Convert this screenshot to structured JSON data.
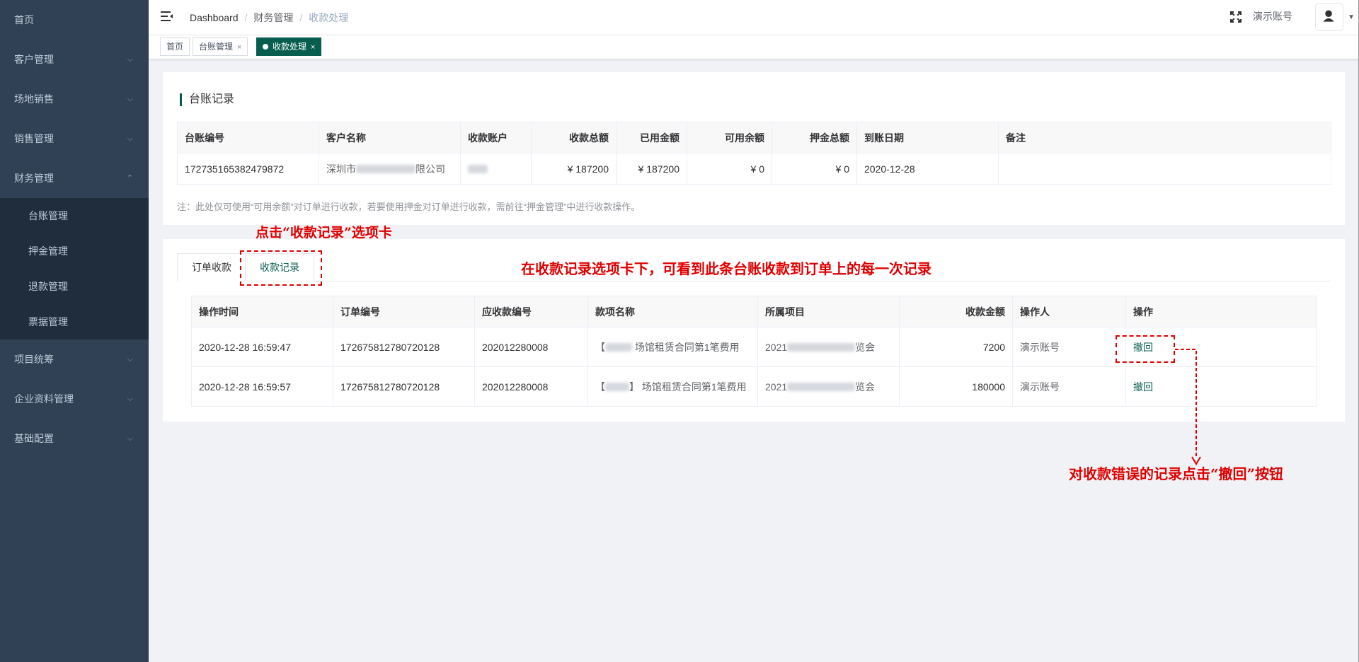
{
  "sidebar": {
    "items": [
      {
        "label": "首页",
        "arrow": ""
      },
      {
        "label": "客户管理",
        "arrow": "⌵"
      },
      {
        "label": "场地销售",
        "arrow": "⌵"
      },
      {
        "label": "销售管理",
        "arrow": "⌵"
      },
      {
        "label": "财务管理",
        "arrow": "⌃"
      }
    ],
    "finance_sub": [
      "台账管理",
      "押金管理",
      "退款管理",
      "票据管理"
    ],
    "items_after": [
      {
        "label": "项目统筹",
        "arrow": "⌵"
      },
      {
        "label": "企业资料管理",
        "arrow": "⌵"
      },
      {
        "label": "基础配置",
        "arrow": "⌵"
      }
    ]
  },
  "header": {
    "breadcrumb": [
      "Dashboard",
      "财务管理",
      "收款处理"
    ],
    "user_name": "演示账号"
  },
  "tags": [
    {
      "label": "首页",
      "closable": false,
      "active": false
    },
    {
      "label": "台账管理",
      "closable": true,
      "active": false
    },
    {
      "label": "收款处理",
      "closable": true,
      "active": true
    }
  ],
  "ledger": {
    "title": "台账记录",
    "columns": [
      "台账编号",
      "客户名称",
      "收款账户",
      "收款总额",
      "已用金额",
      "可用余额",
      "押金总额",
      "到账日期",
      "备注"
    ],
    "row": {
      "id": "172735165382479872",
      "customer_prefix": "深圳市",
      "customer_suffix": "限公司",
      "account": "",
      "total": "¥ 187200",
      "used": "¥ 187200",
      "available": "¥ 0",
      "deposit": "¥ 0",
      "date": "2020-12-28",
      "remark": ""
    },
    "note": "注：此处仅可使用“可用余额”对订单进行收款，若要使用押金对订单进行收款，需前往“押金管理”中进行收款操作。"
  },
  "tabs": [
    "订单收款",
    "收款记录"
  ],
  "records": {
    "columns": [
      "操作时间",
      "订单编号",
      "应收款编号",
      "款项名称",
      "所属项目",
      "收款金额",
      "操作人",
      "操作"
    ],
    "rows": [
      {
        "time": "2020-12-28 16:59:47",
        "order": "172675812780720128",
        "receivable": "202012280008",
        "item_prefix": "【",
        "item_suffix": "场馆租赁合同第1笔费用",
        "project_prefix": "2021",
        "project_suffix": "览会",
        "amount": "7200",
        "operator": "演示账号",
        "action": "撤回"
      },
      {
        "time": "2020-12-28 16:59:57",
        "order": "172675812780720128",
        "receivable": "202012280008",
        "item_prefix": "【",
        "item_suffix": "】 场馆租赁合同第1笔费用",
        "project_prefix": "2021",
        "project_suffix": "览会",
        "amount": "180000",
        "operator": "演示账号",
        "action": "撤回"
      }
    ]
  },
  "annotations": {
    "tab_hint": "点击“收款记录”选项卡",
    "records_hint": "在收款记录选项卡下，可看到此条台账收款到订单上的每一次记录",
    "revoke_hint": "对收款错误的记录点击“撤回”按钮"
  },
  "colors": {
    "accent": "#075e4f",
    "sidebar_bg": "#304156",
    "annotation": "#e00000"
  }
}
